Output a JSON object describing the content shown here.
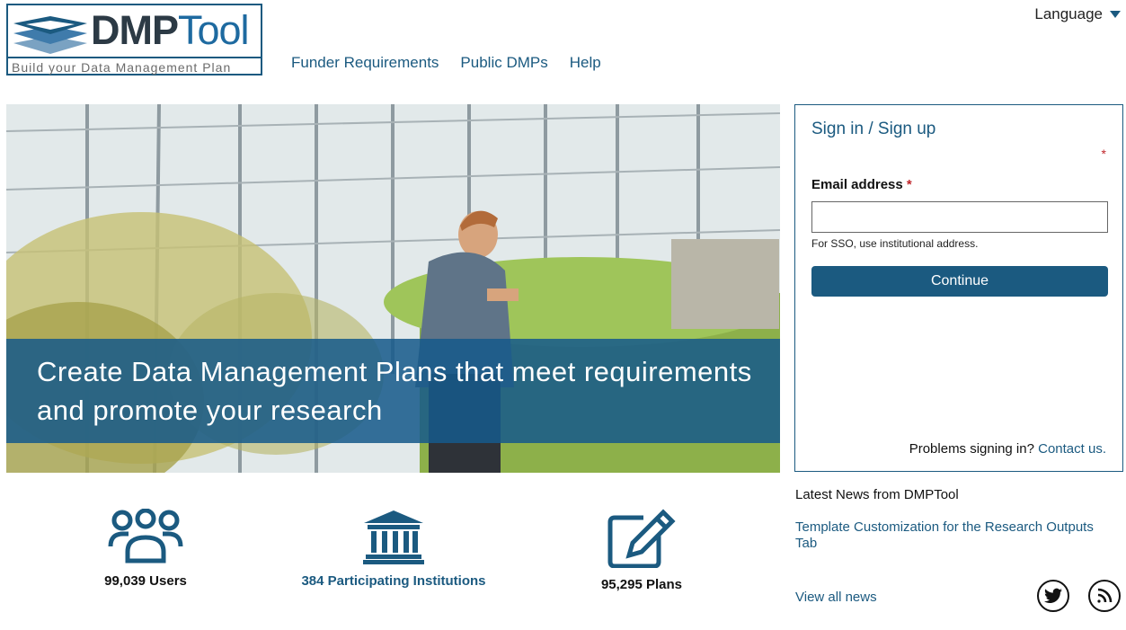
{
  "logo": {
    "word_bold": "DMP",
    "word_light": "Tool",
    "tagline": "Build your Data Management Plan"
  },
  "nav": {
    "items": [
      "Funder Requirements",
      "Public DMPs",
      "Help"
    ]
  },
  "language": {
    "label": "Language"
  },
  "hero": {
    "caption": "Create Data Management Plans that meet requirements and promote your research"
  },
  "signin": {
    "title": "Sign in / Sign up",
    "required_marker": "*",
    "email_label": "Email address",
    "email_value": "",
    "hint": "For SSO, use institutional address.",
    "continue_label": "Continue",
    "problems_text": "Problems signing in?",
    "contact_link": "Contact us."
  },
  "stats": {
    "users": "99,039 Users",
    "institutions": "384 Participating Institutions",
    "plans": "95,295 Plans"
  },
  "news": {
    "heading": "Latest News from DMPTool",
    "item": "Template Customization for the Research Outputs Tab",
    "view_all": "View all news"
  },
  "icons": {
    "users": "users-icon",
    "institution": "institution-icon",
    "plans": "edit-icon",
    "twitter": "twitter-icon",
    "rss": "rss-icon"
  },
  "colors": {
    "brand": "#1b5a80",
    "required": "#c0262b"
  }
}
